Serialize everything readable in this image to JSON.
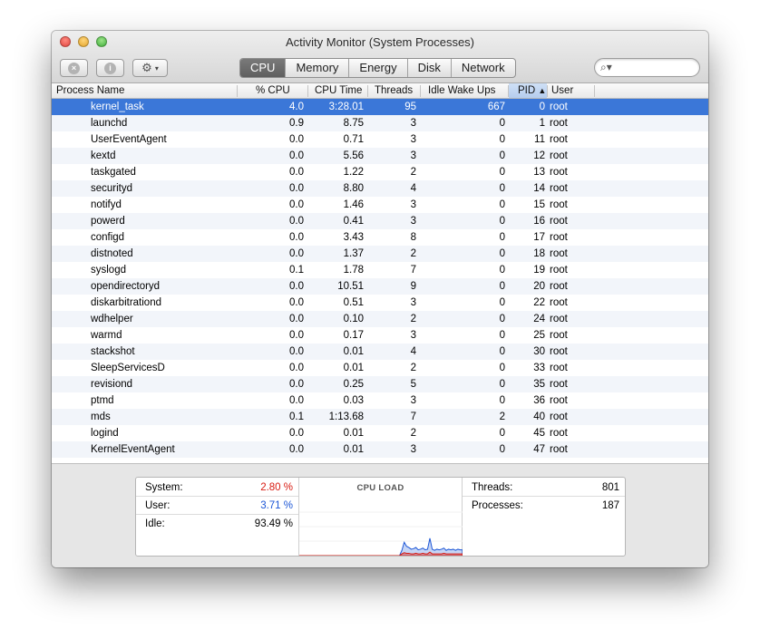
{
  "window": {
    "title": "Activity Monitor (System Processes)"
  },
  "toolbar": {
    "stop_icon": "x-circle-icon",
    "info_icon": "info-circle-icon",
    "action_icon": "gear-icon",
    "stop_glyph": "×",
    "info_glyph": "i",
    "gear_glyph": "⚙",
    "caret_glyph": "▾"
  },
  "tabs": [
    {
      "label": "CPU",
      "active": true
    },
    {
      "label": "Memory",
      "active": false
    },
    {
      "label": "Energy",
      "active": false
    },
    {
      "label": "Disk",
      "active": false
    },
    {
      "label": "Network",
      "active": false
    }
  ],
  "search": {
    "value": "",
    "placeholder": "",
    "icon": "search-icon",
    "glyph": "⌕▾"
  },
  "columns": {
    "name": "Process Name",
    "cpu": "% CPU",
    "cpu_time": "CPU Time",
    "threads": "Threads",
    "idle_wake": "Idle Wake Ups",
    "pid": "PID",
    "pid_sort_glyph": "▲",
    "user": "User"
  },
  "processes": [
    {
      "name": "kernel_task",
      "cpu": "4.0",
      "time": "3:28.01",
      "threads": "95",
      "wake": "667",
      "pid": "0",
      "user": "root",
      "selected": true
    },
    {
      "name": "launchd",
      "cpu": "0.9",
      "time": "8.75",
      "threads": "3",
      "wake": "0",
      "pid": "1",
      "user": "root"
    },
    {
      "name": "UserEventAgent",
      "cpu": "0.0",
      "time": "0.71",
      "threads": "3",
      "wake": "0",
      "pid": "11",
      "user": "root"
    },
    {
      "name": "kextd",
      "cpu": "0.0",
      "time": "5.56",
      "threads": "3",
      "wake": "0",
      "pid": "12",
      "user": "root"
    },
    {
      "name": "taskgated",
      "cpu": "0.0",
      "time": "1.22",
      "threads": "2",
      "wake": "0",
      "pid": "13",
      "user": "root"
    },
    {
      "name": "securityd",
      "cpu": "0.0",
      "time": "8.80",
      "threads": "4",
      "wake": "0",
      "pid": "14",
      "user": "root"
    },
    {
      "name": "notifyd",
      "cpu": "0.0",
      "time": "1.46",
      "threads": "3",
      "wake": "0",
      "pid": "15",
      "user": "root"
    },
    {
      "name": "powerd",
      "cpu": "0.0",
      "time": "0.41",
      "threads": "3",
      "wake": "0",
      "pid": "16",
      "user": "root"
    },
    {
      "name": "configd",
      "cpu": "0.0",
      "time": "3.43",
      "threads": "8",
      "wake": "0",
      "pid": "17",
      "user": "root"
    },
    {
      "name": "distnoted",
      "cpu": "0.0",
      "time": "1.37",
      "threads": "2",
      "wake": "0",
      "pid": "18",
      "user": "root"
    },
    {
      "name": "syslogd",
      "cpu": "0.1",
      "time": "1.78",
      "threads": "7",
      "wake": "0",
      "pid": "19",
      "user": "root"
    },
    {
      "name": "opendirectoryd",
      "cpu": "0.0",
      "time": "10.51",
      "threads": "9",
      "wake": "0",
      "pid": "20",
      "user": "root"
    },
    {
      "name": "diskarbitrationd",
      "cpu": "0.0",
      "time": "0.51",
      "threads": "3",
      "wake": "0",
      "pid": "22",
      "user": "root"
    },
    {
      "name": "wdhelper",
      "cpu": "0.0",
      "time": "0.10",
      "threads": "2",
      "wake": "0",
      "pid": "24",
      "user": "root"
    },
    {
      "name": "warmd",
      "cpu": "0.0",
      "time": "0.17",
      "threads": "3",
      "wake": "0",
      "pid": "25",
      "user": "root"
    },
    {
      "name": "stackshot",
      "cpu": "0.0",
      "time": "0.01",
      "threads": "4",
      "wake": "0",
      "pid": "30",
      "user": "root"
    },
    {
      "name": "SleepServicesD",
      "cpu": "0.0",
      "time": "0.01",
      "threads": "2",
      "wake": "0",
      "pid": "33",
      "user": "root"
    },
    {
      "name": "revisiond",
      "cpu": "0.0",
      "time": "0.25",
      "threads": "5",
      "wake": "0",
      "pid": "35",
      "user": "root"
    },
    {
      "name": "ptmd",
      "cpu": "0.0",
      "time": "0.03",
      "threads": "3",
      "wake": "0",
      "pid": "36",
      "user": "root"
    },
    {
      "name": "mds",
      "cpu": "0.1",
      "time": "1:13.68",
      "threads": "7",
      "wake": "2",
      "pid": "40",
      "user": "root"
    },
    {
      "name": "logind",
      "cpu": "0.0",
      "time": "0.01",
      "threads": "2",
      "wake": "0",
      "pid": "45",
      "user": "root"
    },
    {
      "name": "KernelEventAgent",
      "cpu": "0.0",
      "time": "0.01",
      "threads": "3",
      "wake": "0",
      "pid": "47",
      "user": "root"
    }
  ],
  "summary": {
    "system_label": "System:",
    "system_value": "2.80 %",
    "user_label": "User:",
    "user_value": "3.71 %",
    "idle_label": "Idle:",
    "idle_value": "93.49 %",
    "cpu_load_title": "CPU LOAD",
    "threads_label": "Threads:",
    "threads_value": "801",
    "processes_label": "Processes:",
    "processes_value": "187"
  },
  "cpu_load_history": {
    "user_pct": [
      0,
      0,
      0,
      0,
      0,
      0,
      0,
      0,
      0,
      0,
      0,
      0,
      0,
      0,
      0,
      0,
      0,
      0,
      0,
      0,
      0,
      0,
      0,
      0,
      0,
      0,
      0,
      0,
      0,
      0,
      0,
      0,
      0,
      0,
      0,
      0,
      0,
      0,
      0,
      0,
      0,
      0,
      0,
      0,
      6,
      18,
      12,
      10,
      8,
      9,
      10,
      7,
      8,
      9,
      7,
      8,
      24,
      8,
      6,
      8,
      7,
      8,
      9,
      6,
      8,
      7,
      8,
      6,
      8,
      7,
      7
    ],
    "system_pct": [
      0,
      0,
      0,
      0,
      0,
      0,
      0,
      0,
      0,
      0,
      0,
      0,
      0,
      0,
      0,
      0,
      0,
      0,
      0,
      0,
      0,
      0,
      0,
      0,
      0,
      0,
      0,
      0,
      0,
      0,
      0,
      0,
      0,
      0,
      0,
      0,
      0,
      0,
      0,
      0,
      0,
      0,
      0,
      0,
      3,
      5,
      4,
      4,
      3,
      3,
      4,
      3,
      3,
      4,
      3,
      3,
      6,
      3,
      3,
      3,
      3,
      3,
      4,
      3,
      3,
      3,
      3,
      3,
      3,
      3,
      3
    ]
  },
  "colors": {
    "selection": "#3b77d8",
    "system": "#d81b12",
    "user": "#1c56d6"
  }
}
